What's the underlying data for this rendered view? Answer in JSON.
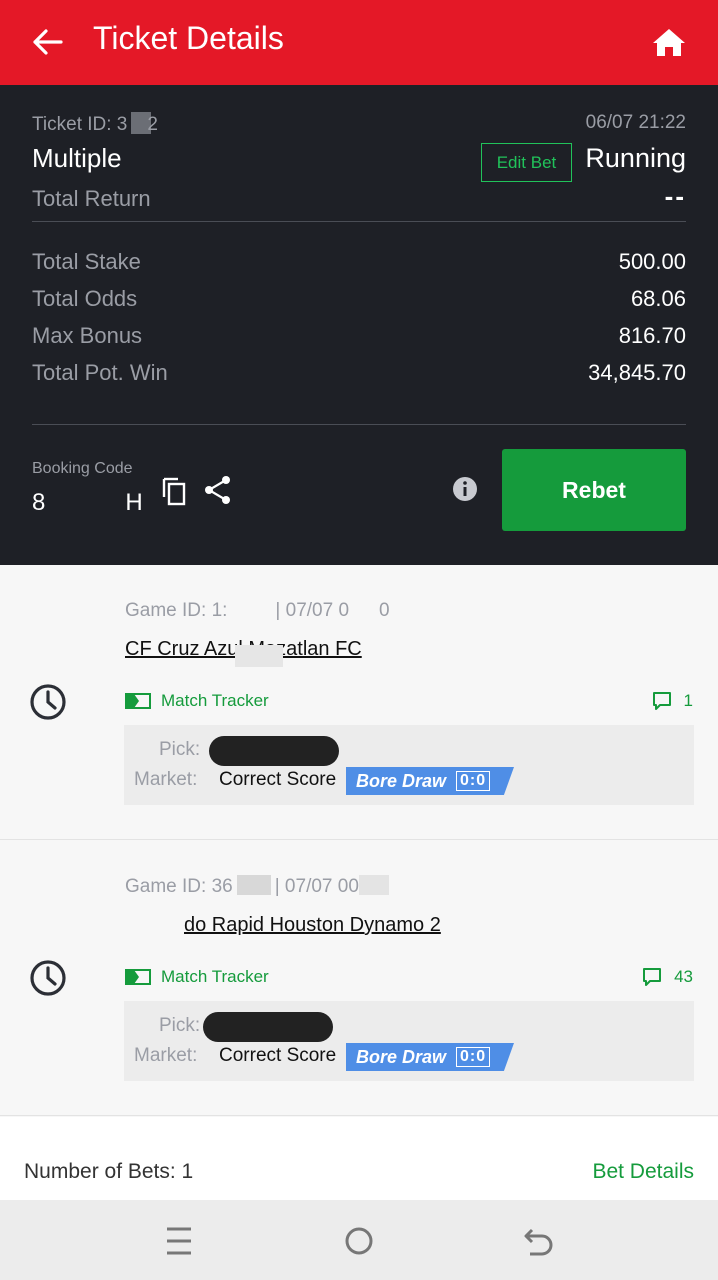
{
  "header": {
    "title": "Ticket Details",
    "back_icon": "arrow-left-icon",
    "home_icon": "home-icon",
    "background_color": "#e41827"
  },
  "summary": {
    "ticket_id_prefix": "Ticket ID: 3",
    "ticket_id_suffix": "2",
    "date": "06/07 21:22",
    "bet_type": "Multiple",
    "edit_bet_label": "Edit Bet",
    "status": "Running",
    "total_return_label": "Total Return",
    "total_return_value": "--",
    "rows": [
      {
        "label": "Total Stake",
        "value": "500.00"
      },
      {
        "label": "Total Odds",
        "value": "68.06"
      },
      {
        "label": "Max Bonus",
        "value": "816.70"
      },
      {
        "label": "Total Pot. Win",
        "value": "34,845.70"
      }
    ],
    "booking_code_label": "Booking Code",
    "booking_code_start": "8",
    "booking_code_end": "H",
    "rebet_label": "Rebet",
    "rebet_color": "#159b3c"
  },
  "selections": [
    {
      "game_id_prefix": "Game ID: 1:",
      "game_id_middle": "| 07/07 0",
      "game_id_end": "0",
      "match": "CF Cruz Azul Mazatlan FC",
      "tracker_label": "Match Tracker",
      "comments_count": "1",
      "pick_label": "Pick:",
      "market_label": "Market:",
      "market_value": "Correct Score",
      "tag_label": "Bore Draw",
      "tag_score": "0:0"
    },
    {
      "game_id_prefix": "Game ID: 36",
      "game_id_middle": "| 07/07 00",
      "game_id_end": "",
      "match": "do Rapid Houston Dynamo 2",
      "tracker_label": "Match Tracker",
      "comments_count": "43",
      "pick_label": "Pick:",
      "market_label": "Market:",
      "market_value": "Correct Score",
      "tag_label": "Bore Draw",
      "tag_score": "0:0"
    }
  ],
  "footer": {
    "bets_count": "Number of Bets: 1",
    "bet_details_label": "Bet Details"
  },
  "nav": {
    "menu_icon": "menu-icon",
    "home_icon": "circle-home-icon",
    "back_icon": "back-return-icon"
  }
}
